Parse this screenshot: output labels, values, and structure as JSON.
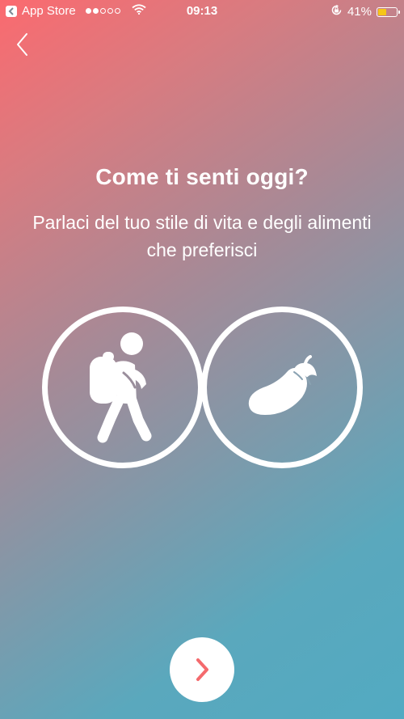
{
  "status_bar": {
    "back_app_label": "App Store",
    "time": "09:13",
    "battery_percent": "41%",
    "battery_level": 0.41,
    "signal_bars_filled": 2,
    "signal_bars_total": 5
  },
  "screen": {
    "title": "Come ti senti oggi?",
    "subtitle": "Parlaci del tuo stile di vita e degli alimenti che preferisci",
    "options": [
      {
        "icon": "hiker-icon"
      },
      {
        "icon": "eggplant-icon"
      }
    ]
  },
  "colors": {
    "gradient_start": "#fb6a6f",
    "gradient_end": "#52aac2",
    "next_arrow": "#f46a6d",
    "battery_fill": "#f5c518"
  }
}
